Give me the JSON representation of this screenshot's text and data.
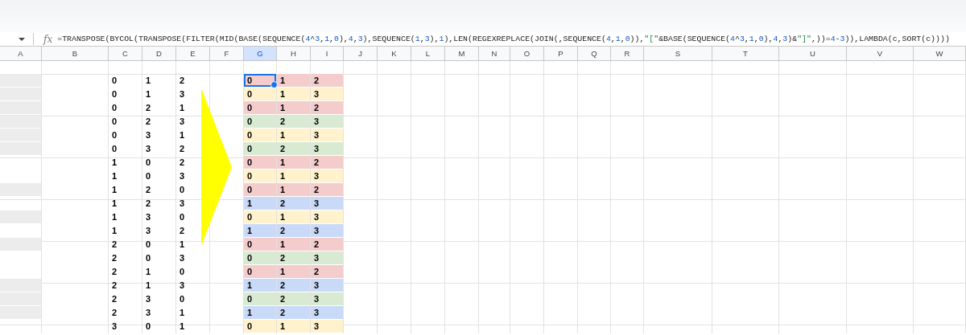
{
  "formula_bar": {
    "label": "fx",
    "formula": "=TRANSPOSE(BYCOL(TRANSPOSE(FILTER(MID(BASE(SEQUENCE(4^3,1,0),4,3),SEQUENCE(1,3),1),LEN(REGEXREPLACE(JOIN(,SEQUENCE(4,1,0)),\"[\"&BASE(SEQUENCE(4^3,1,0),4,3)&\"]\",))=4-3)),LAMBDA(c,SORT(c))))"
  },
  "columns": [
    {
      "label": "A",
      "selected": false
    },
    {
      "label": "B",
      "selected": false
    },
    {
      "label": "C",
      "selected": false
    },
    {
      "label": "D",
      "selected": false
    },
    {
      "label": "E",
      "selected": false
    },
    {
      "label": "F",
      "selected": false
    },
    {
      "label": "G",
      "selected": true
    },
    {
      "label": "H",
      "selected": false
    },
    {
      "label": "I",
      "selected": false
    },
    {
      "label": "J",
      "selected": false
    },
    {
      "label": "K",
      "selected": false
    },
    {
      "label": "L",
      "selected": false
    },
    {
      "label": "M",
      "selected": false
    },
    {
      "label": "N",
      "selected": false
    },
    {
      "label": "O",
      "selected": false
    },
    {
      "label": "P",
      "selected": false
    },
    {
      "label": "Q",
      "selected": false
    },
    {
      "label": "R",
      "selected": false
    },
    {
      "label": "S",
      "selected": false
    },
    {
      "label": "T",
      "selected": false
    },
    {
      "label": "U",
      "selected": false
    },
    {
      "label": "V",
      "selected": false
    },
    {
      "label": "W",
      "selected": false
    }
  ],
  "rows": [
    {
      "shaded": true,
      "source": [
        "0",
        "1",
        "2"
      ],
      "color": "#f4cccc",
      "result": [
        {
          "text": "0",
          "selected": true
        },
        {
          "text": "1",
          "selected": false
        },
        {
          "text": "2",
          "selected": false
        }
      ]
    },
    {
      "shaded": true,
      "source": [
        "0",
        "1",
        "3"
      ],
      "color": "#fff2cc",
      "result": [
        {
          "text": "0",
          "selected": false
        },
        {
          "text": "1",
          "selected": false
        },
        {
          "text": "3",
          "selected": false
        }
      ]
    },
    {
      "shaded": true,
      "source": [
        "0",
        "2",
        "1"
      ],
      "color": "#f4cccc",
      "result": [
        {
          "text": "0",
          "selected": false
        },
        {
          "text": "1",
          "selected": false
        },
        {
          "text": "2",
          "selected": false
        }
      ]
    },
    {
      "shaded": true,
      "source": [
        "0",
        "2",
        "3"
      ],
      "color": "#d9ead3",
      "result": [
        {
          "text": "0",
          "selected": false
        },
        {
          "text": "2",
          "selected": false
        },
        {
          "text": "3",
          "selected": false
        }
      ]
    },
    {
      "shaded": true,
      "source": [
        "0",
        "3",
        "1"
      ],
      "color": "#fff2cc",
      "result": [
        {
          "text": "0",
          "selected": false
        },
        {
          "text": "1",
          "selected": false
        },
        {
          "text": "3",
          "selected": false
        }
      ]
    },
    {
      "shaded": true,
      "source": [
        "0",
        "3",
        "2"
      ],
      "color": "#d9ead3",
      "result": [
        {
          "text": "0",
          "selected": false
        },
        {
          "text": "2",
          "selected": false
        },
        {
          "text": "3",
          "selected": false
        }
      ]
    },
    {
      "shaded": false,
      "source": [
        "1",
        "0",
        "2"
      ],
      "color": "#f4cccc",
      "result": [
        {
          "text": "0",
          "selected": false
        },
        {
          "text": "1",
          "selected": false
        },
        {
          "text": "2",
          "selected": false
        }
      ]
    },
    {
      "shaded": false,
      "source": [
        "1",
        "0",
        "3"
      ],
      "color": "#fff2cc",
      "result": [
        {
          "text": "0",
          "selected": false
        },
        {
          "text": "1",
          "selected": false
        },
        {
          "text": "3",
          "selected": false
        }
      ]
    },
    {
      "shaded": true,
      "source": [
        "1",
        "2",
        "0"
      ],
      "color": "#f4cccc",
      "result": [
        {
          "text": "0",
          "selected": false
        },
        {
          "text": "1",
          "selected": false
        },
        {
          "text": "2",
          "selected": false
        }
      ]
    },
    {
      "shaded": false,
      "source": [
        "1",
        "2",
        "3"
      ],
      "color": "#c9daf8",
      "result": [
        {
          "text": "1",
          "selected": false
        },
        {
          "text": "2",
          "selected": false
        },
        {
          "text": "3",
          "selected": false
        }
      ]
    },
    {
      "shaded": true,
      "source": [
        "1",
        "3",
        "0"
      ],
      "color": "#fff2cc",
      "result": [
        {
          "text": "0",
          "selected": false
        },
        {
          "text": "1",
          "selected": false
        },
        {
          "text": "3",
          "selected": false
        }
      ]
    },
    {
      "shaded": false,
      "source": [
        "1",
        "3",
        "2"
      ],
      "color": "#c9daf8",
      "result": [
        {
          "text": "1",
          "selected": false
        },
        {
          "text": "2",
          "selected": false
        },
        {
          "text": "3",
          "selected": false
        }
      ]
    },
    {
      "shaded": true,
      "source": [
        "2",
        "0",
        "1"
      ],
      "color": "#f4cccc",
      "result": [
        {
          "text": "0",
          "selected": false
        },
        {
          "text": "1",
          "selected": false
        },
        {
          "text": "2",
          "selected": false
        }
      ]
    },
    {
      "shaded": false,
      "source": [
        "2",
        "0",
        "3"
      ],
      "color": "#d9ead3",
      "result": [
        {
          "text": "0",
          "selected": false
        },
        {
          "text": "2",
          "selected": false
        },
        {
          "text": "3",
          "selected": false
        }
      ]
    },
    {
      "shaded": false,
      "source": [
        "2",
        "1",
        "0"
      ],
      "color": "#f4cccc",
      "result": [
        {
          "text": "0",
          "selected": false
        },
        {
          "text": "1",
          "selected": false
        },
        {
          "text": "2",
          "selected": false
        }
      ]
    },
    {
      "shaded": true,
      "source": [
        "2",
        "1",
        "3"
      ],
      "color": "#c9daf8",
      "result": [
        {
          "text": "1",
          "selected": false
        },
        {
          "text": "2",
          "selected": false
        },
        {
          "text": "3",
          "selected": false
        }
      ]
    },
    {
      "shaded": true,
      "source": [
        "2",
        "3",
        "0"
      ],
      "color": "#d9ead3",
      "result": [
        {
          "text": "0",
          "selected": false
        },
        {
          "text": "2",
          "selected": false
        },
        {
          "text": "3",
          "selected": false
        }
      ]
    },
    {
      "shaded": true,
      "source": [
        "2",
        "3",
        "1"
      ],
      "color": "#c9daf8",
      "result": [
        {
          "text": "1",
          "selected": false
        },
        {
          "text": "2",
          "selected": false
        },
        {
          "text": "3",
          "selected": false
        }
      ]
    },
    {
      "shaded": false,
      "source": [
        "3",
        "0",
        "1"
      ],
      "color": "#fff2cc",
      "result": [
        {
          "text": "0",
          "selected": false
        },
        {
          "text": "1",
          "selected": false
        },
        {
          "text": "3",
          "selected": false
        }
      ]
    }
  ]
}
